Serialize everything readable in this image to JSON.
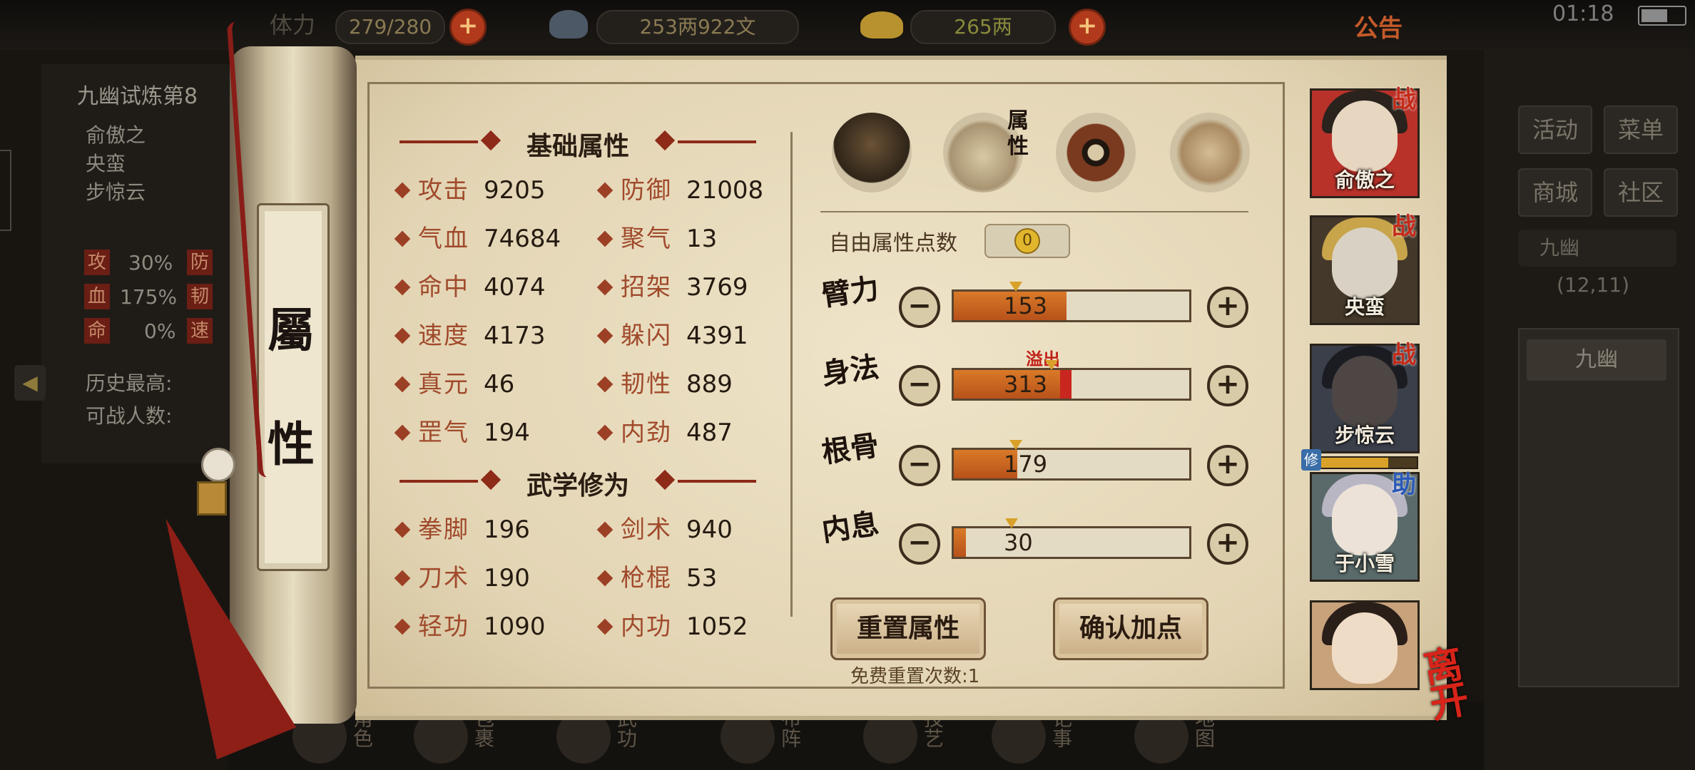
{
  "topbar": {
    "stamina_label": "体力",
    "stamina_value": "279/280",
    "silver": "253两922文",
    "gold": "265两",
    "announcement": "公告",
    "time": "01:18"
  },
  "left_panel": {
    "title": "九幽试炼第8",
    "members": [
      "俞傲之",
      "央蛮",
      "步惊云"
    ],
    "stats": [
      {
        "tag": "攻",
        "value": "30%",
        "tag2": "防"
      },
      {
        "tag": "血",
        "value": "175%",
        "tag2": "韧"
      },
      {
        "tag": "命",
        "value": "0%",
        "tag2": "速"
      }
    ],
    "history_best": "历史最高:",
    "fighters": "可战人数:"
  },
  "scroll_title": [
    "屬",
    "性"
  ],
  "basic": {
    "title": "基础属性",
    "attrs": [
      {
        "name": "攻击",
        "value": "9205"
      },
      {
        "name": "防御",
        "value": "21008"
      },
      {
        "name": "气血",
        "value": "74684"
      },
      {
        "name": "聚气",
        "value": "13"
      },
      {
        "name": "命中",
        "value": "4074"
      },
      {
        "name": "招架",
        "value": "3769"
      },
      {
        "name": "速度",
        "value": "4173"
      },
      {
        "name": "躲闪",
        "value": "4391"
      },
      {
        "name": "真元",
        "value": "46"
      },
      {
        "name": "韧性",
        "value": "889"
      },
      {
        "name": "罡气",
        "value": "194"
      },
      {
        "name": "内劲",
        "value": "487"
      }
    ]
  },
  "martial": {
    "title": "武学修为",
    "attrs": [
      {
        "name": "拳脚",
        "value": "196"
      },
      {
        "name": "剑术",
        "value": "940"
      },
      {
        "name": "刀术",
        "value": "190"
      },
      {
        "name": "枪棍",
        "value": "53"
      },
      {
        "name": "轻功",
        "value": "1090"
      },
      {
        "name": "内功",
        "value": "1052"
      }
    ]
  },
  "tabs": {
    "active_tab": "属性"
  },
  "free_points": {
    "label": "自由属性点数",
    "value": "0"
  },
  "allocations": [
    {
      "label": "臂力",
      "value": "153",
      "fill": 0.48
    },
    {
      "label": "身法",
      "value": "313",
      "fill": 0.45,
      "overflow": 0.05,
      "overflow_label": "溢出"
    },
    {
      "label": "根骨",
      "value": "179",
      "fill": 0.27
    },
    {
      "label": "内息",
      "value": "30",
      "fill": 0.05
    }
  ],
  "buttons": {
    "reset": "重置属性",
    "confirm": "确认加点",
    "free_reset": "免费重置次数:1"
  },
  "characters": [
    {
      "name": "俞傲之",
      "badge": "战"
    },
    {
      "name": "央蛮",
      "badge": "战"
    },
    {
      "name": "步惊云",
      "badge": "战",
      "sub": "修"
    },
    {
      "name": "于小雪",
      "badge": "助"
    },
    {
      "name": "",
      "badge": ""
    }
  ],
  "leave": "离开",
  "right_menu": {
    "items": [
      "活动",
      "菜单",
      "商城",
      "社区"
    ],
    "location": "九幽",
    "coords": "(12,11)",
    "map_name": "九幽"
  },
  "bottom_nav": [
    "角色",
    "包裹",
    "武功",
    "布阵",
    "技艺",
    "记事",
    "地图"
  ],
  "colors": {
    "accent_red": "#c42a18",
    "bar_orange": "#d97a28",
    "paper": "#e8dcc0"
  }
}
